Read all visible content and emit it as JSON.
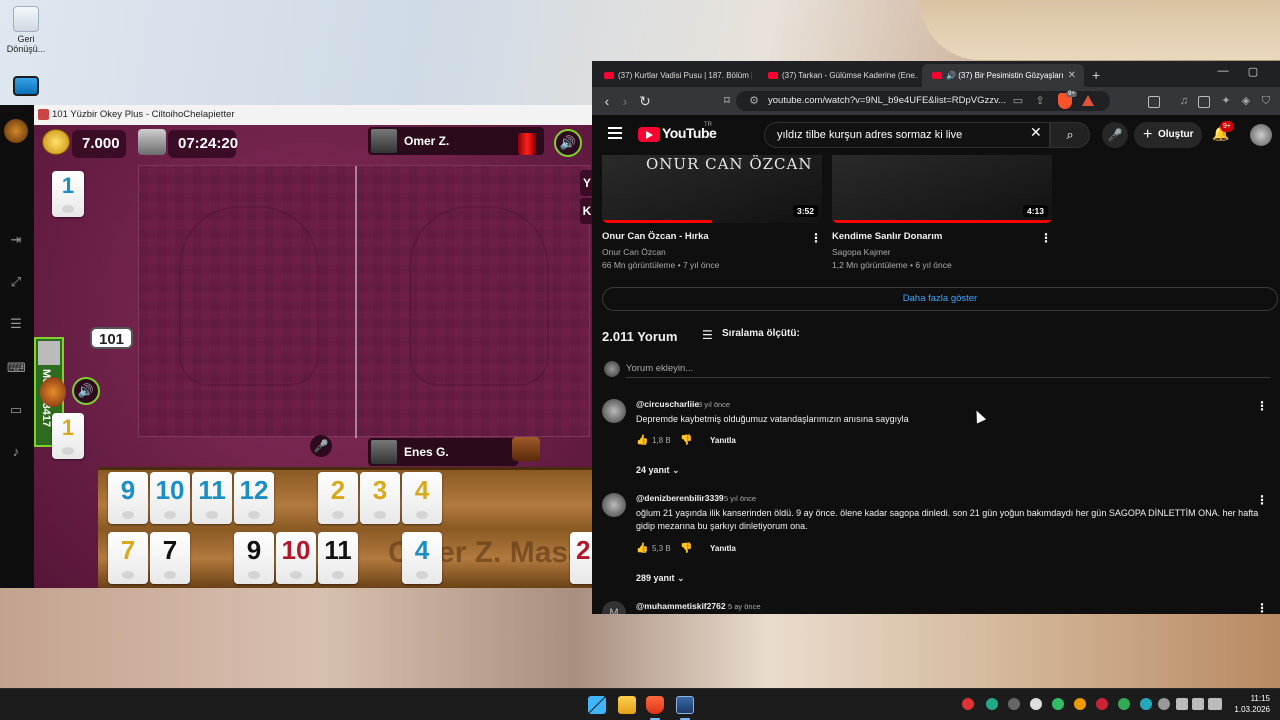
{
  "desktop": {
    "icons": [
      {
        "label": "Geri Dönüşü..."
      },
      {
        "label": ""
      }
    ]
  },
  "game": {
    "window_title": "101 Yüzbir Okey Plus - CiltoihoChelapietter",
    "coins": "7.000",
    "timer": "07:24:20",
    "top_player": "Omer Z.",
    "bottom_player": "Enes G.",
    "left_player": "M64128417",
    "right_labels": [
      "Y",
      "K"
    ],
    "score_badge": "101",
    "side_tiles": [
      {
        "value": "1",
        "color": "blue"
      },
      {
        "value": "1",
        "color": "yellow"
      }
    ],
    "rack_text": [
      "Omer Z. Masa"
    ],
    "rack_row1": [
      {
        "value": "9",
        "color": "blue"
      },
      {
        "value": "10",
        "color": "blue"
      },
      {
        "value": "11",
        "color": "blue"
      },
      {
        "value": "12",
        "color": "blue"
      },
      {
        "value": "2",
        "color": "yellow"
      },
      {
        "value": "3",
        "color": "yellow"
      },
      {
        "value": "4",
        "color": "yellow"
      }
    ],
    "rack_row2": [
      {
        "value": "7",
        "color": "yellow"
      },
      {
        "value": "7",
        "color": "black"
      },
      {
        "value": "9",
        "color": "black"
      },
      {
        "value": "10",
        "color": "red"
      },
      {
        "value": "11",
        "color": "black"
      },
      {
        "value": "4",
        "color": "blue"
      },
      {
        "value": "2",
        "color": "red"
      }
    ]
  },
  "browser": {
    "tabs": [
      {
        "title": "(37) Kurtlar Vadisi Pusu | 187. Bölüm |",
        "active": false
      },
      {
        "title": "(37) Tarkan - Gülümse Kaderine (Ene...",
        "active": false
      },
      {
        "title": "(37) Bir Pesimistin Gözyaşları",
        "active": true
      }
    ],
    "url": "youtube.com/watch?v=9NL_b9e4UFE&list=RDpVGzzv...",
    "brave_badge": "9+"
  },
  "youtube": {
    "logo": "YouTube",
    "logo_country": "TR",
    "search_value": "yıldız tilbe kurşun adres sormaz ki live",
    "create_label": "Oluştur",
    "notif_badge": "9+",
    "videos": [
      {
        "title": "Onur Can Özcan - Hırka",
        "channel": "Onur Can Özcan",
        "views": "66 Mn görüntüleme",
        "age": "7 yıl önce",
        "duration": "3:52",
        "overlay": "ONUR CAN ÖZCAN"
      },
      {
        "title": "Kendime Sanlır Donarım",
        "channel": "Sagopa Kajmer",
        "views": "1,2 Mn görüntüleme",
        "age": "6 yıl önce",
        "duration": "4:13",
        "overlay": ""
      }
    ],
    "show_more": "Daha fazla göster",
    "comment_count": "2.011 Yorum",
    "sort_label": "Sıralama ölçütü:",
    "add_comment_placeholder": "Yorum ekleyin...",
    "comments": [
      {
        "user": "@circuscharliie",
        "time": "3 yıl önce",
        "text": "Depremde kaybetmiş olduğumuz vatandaşlarımızın anısına saygıyla",
        "likes": "1,8 B",
        "reply": "Yanıtla",
        "replies": "24 yanıt"
      },
      {
        "user": "@denizberenbilir3339",
        "time": "5 yıl önce",
        "text": "oğlum 21 yaşında ilik kanserinden öldü. 9 ay önce. ölene kadar sagopa dinledi. son 21 gün yoğun bakımdaydı her gün SAGOPA DİNLETTİM ONA. her hafta gidip mezarına bu şarkıyı dinletiyorum ona.",
        "likes": "5,3 B",
        "reply": "Yanıtla",
        "replies": "289 yanıt"
      },
      {
        "user": "@muhammetiskif2762",
        "time": "5 ay önce",
        "avatar_letter": "M"
      }
    ]
  },
  "taskbar": {
    "time": "11:15",
    "date": "1.03.2026"
  }
}
